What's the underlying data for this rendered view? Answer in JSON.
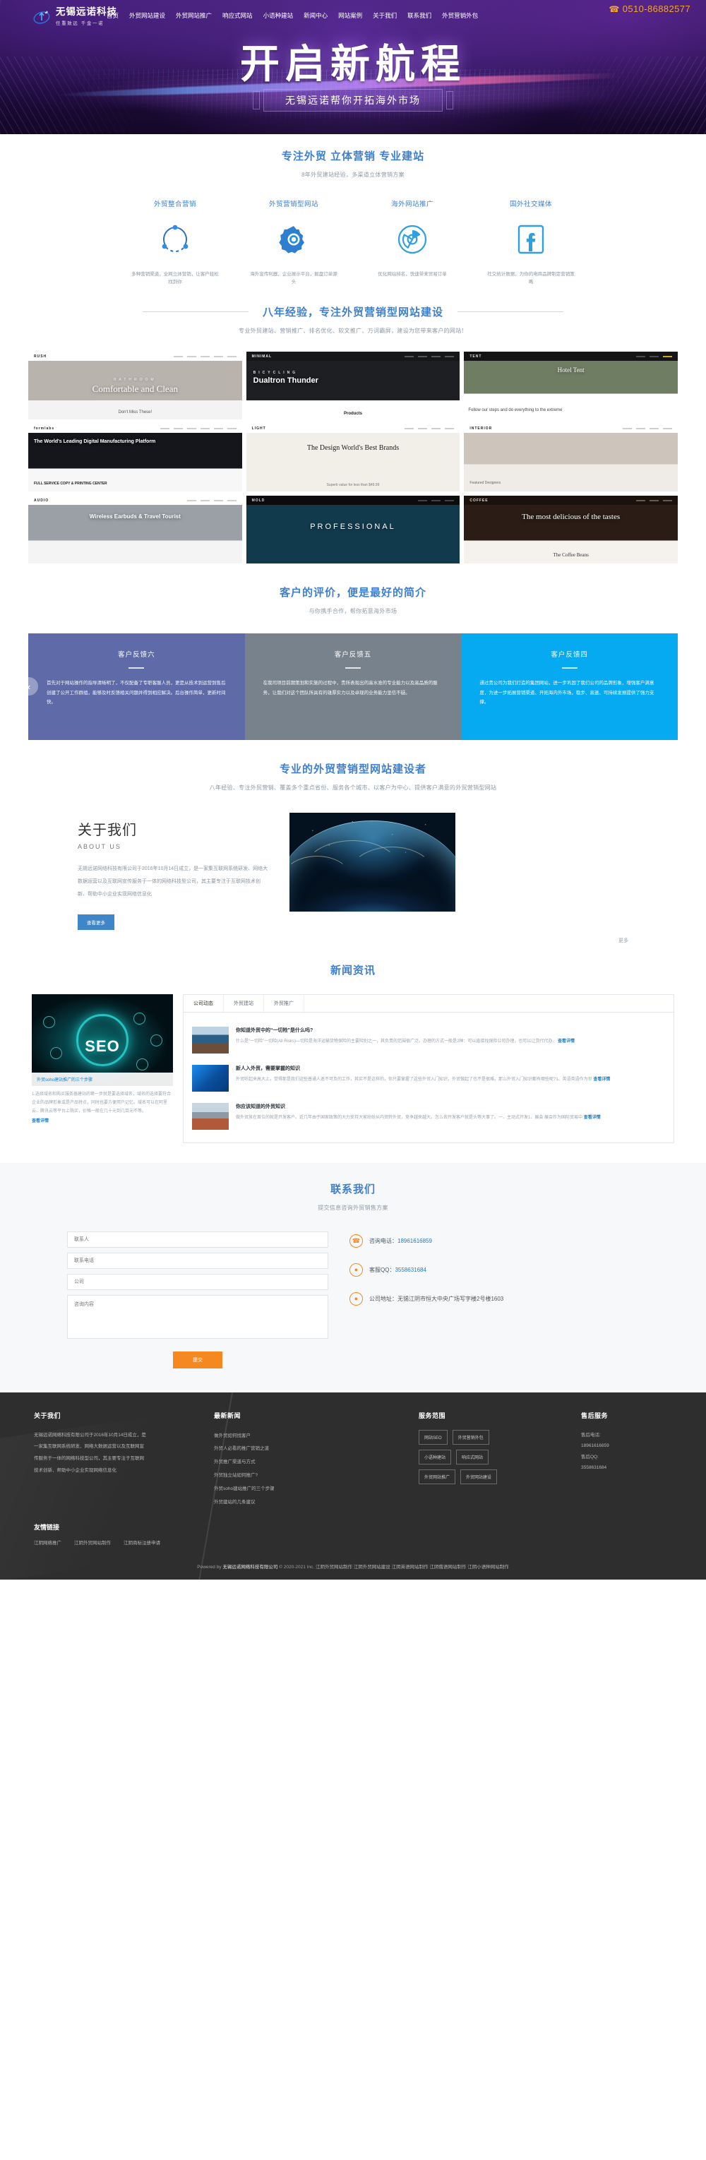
{
  "header": {
    "phone": "0510-86882577",
    "phone_icon": "phone-icon",
    "brand_name": "无锡远诺科技",
    "brand_slogan": "任重致远 千金一诺",
    "nav": [
      {
        "label": "首页"
      },
      {
        "label": "外贸网站建设"
      },
      {
        "label": "外贸网站推广"
      },
      {
        "label": "响应式网站"
      },
      {
        "label": "小语种建站"
      },
      {
        "label": "新闻中心"
      },
      {
        "label": "网站案例"
      },
      {
        "label": "关于我们"
      },
      {
        "label": "联系我们"
      },
      {
        "label": "外贸营销外包"
      }
    ]
  },
  "hero": {
    "title": "开启新航程",
    "subtitle": "无锡远诺帮你开拓海外市场"
  },
  "services": {
    "title": "专注外贸 立体营销 专业建站",
    "subtitle": "8年外贸建站经验，多渠道立体营销方案",
    "items": [
      {
        "name": "外贸整合营销",
        "icon": "network-circle-icon",
        "desc": "多种营销渠道，全网立体营销，让客户轻松找到你"
      },
      {
        "name": "外贸营销型网站",
        "icon": "gear-icon",
        "desc": "海外宣传利器，企业展示平台，掘盘订单源头"
      },
      {
        "name": "海外网站推广",
        "icon": "chrome-icon",
        "desc": "优化网站排名，快速带来贸易订单"
      },
      {
        "name": "国外社交媒体",
        "icon": "facebook-icon",
        "desc": "社交统计数据，为你的电商品牌制定营销策略"
      }
    ]
  },
  "cases": {
    "title": "八年经验，专注外贸营销型网站建设",
    "subtitle": "专业外贸建站、营销推广、排名优化、软文推广、万词霸屏，建设为您带来客户的网站！",
    "items": [
      {
        "logo": "RUSH",
        "eyebrow": "BATHROOM",
        "headline": "Comfortable and Clean",
        "footer": "Don't Miss These!",
        "tone": "light"
      },
      {
        "logo": "",
        "eyebrow": "BICYCLING",
        "headline": "Dualtron Thunder",
        "footer": "Products",
        "tone": "dark"
      },
      {
        "logo": "",
        "eyebrow": "",
        "headline": "Hotel Tent",
        "footer": "Follow our steps and do everything to the extreme",
        "tone": "nature"
      },
      {
        "logo": "formlabs",
        "eyebrow": "",
        "headline": "The World's Leading Digital Manufacturing Platform",
        "footer": "FULL SERVICE COPY & PRINTING CENTER",
        "tone": "dark"
      },
      {
        "logo": "LIGHT",
        "eyebrow": "",
        "headline": "The Design World's Best Brands",
        "footer": "Superb value for less than $49.99",
        "tone": "light"
      },
      {
        "logo": "",
        "eyebrow": "",
        "headline": "",
        "footer": "Featured Designers",
        "tone": "interior"
      },
      {
        "logo": "",
        "eyebrow": "",
        "headline": "Wireless Earbuds & Travel Tourist",
        "footer": "",
        "tone": "gray"
      },
      {
        "logo": "MOLD",
        "eyebrow": "",
        "headline": "PROFESSIONAL",
        "footer": "",
        "tone": "teal"
      },
      {
        "logo": "",
        "eyebrow": "",
        "headline": "The most delicious of the tastes",
        "footer": "The Coffee Beans",
        "tone": "coffee"
      }
    ]
  },
  "testimonials": {
    "title": "客户的评价，便是最好的简介",
    "subtitle": "与你携手合作，帮你拓意海外市场",
    "prev_icon": "chevron-left-icon",
    "items": [
      {
        "name": "客户反馈六",
        "text": "首先对于网站操作的指导清晰明了，不仅配备了专职客服人员，更是从技术到运营到售后创建了公开工作群组，能够及时反馈相关问题并得到相应解决。后台操作简单，更新时间快。",
        "color": "#5f6ba8"
      },
      {
        "name": "客户反馈五",
        "text": "在我司项目前期策划和实施的过程中，贵所表现出的高水准的专业能力以及高品质的服务，让我们对这个团队所具有的雄厚实力以及卓现的业务能力坚信不疑。",
        "color": "#78828c"
      },
      {
        "name": "客户反馈四",
        "text": "通过贵公司为我们打造的集团网站，进一步巩固了我们公司的品牌形象，增强客户满意度，为进一步拓展营销渠道、开拓海内外市场，稳步、高速、可持续发展提供了强力支撑。",
        "color": "#06aaf0"
      }
    ]
  },
  "about": {
    "section_title": "专业的外贸营销型网站建设者",
    "section_subtitle": "八年经验、专注外贸营销、覆盖多个重点省份、服务各个城市、以客户为中心、提供客户满意的外贸营销型网站",
    "heading": "关于我们",
    "heading_en": "ABOUT US",
    "body": "无锡远诺网络科技有限公司于2016年10月14日成立，是一家集互联网系统研发、网络大数据运营以及互联网宣传服务于一体的网络科技型公司，其主要专注于互联网技术创新、帮助中小企业实现网络信息化",
    "button": "查看更多",
    "more": "更多"
  },
  "news": {
    "title": "新闻资讯",
    "feature_image_label": "SEO",
    "feature_caption": "外贸soho建站推广的三个步骤",
    "feature_note": "1.选择域名和购买服务器建站的第一步就是要选择域名，域名的选择要符合企业的品牌形象或是产品特点，同时也要方便用户记忆。域名可以在阿里云、腾讯云等平台上购买，价格一般在几十元到几百元不等。",
    "feature_more": "查看详情",
    "tabs": [
      {
        "label": "公司动态",
        "active": true
      },
      {
        "label": "外贸建站",
        "active": false
      },
      {
        "label": "外贸推广",
        "active": false
      }
    ],
    "items": [
      {
        "title": "你知道外贸中的“一切险”是什么吗?",
        "desc": "什么是“一切险”一切险(All Risks)—切险是海洋运输货物保险的主要险别之一，其负责的范围很广泛。办理的方式一般是2种：可以直接找保险公司办理，也可以让货代代办。",
        "link": "查看详情",
        "thumb": "coast-photo"
      },
      {
        "title": "新人入外贸，需要掌握的知识",
        "desc": "外贸听起来高大上，觉得那是我们这些普通人遥不可及的工作，其实不是这样的，你只要掌握了这些外贸入门知识，外贸做起了也不是很难。那么外贸入门知识都有哪些呢?1、英语英语作为世",
        "link": "查看详情",
        "thumb": "blue-cube-photo"
      },
      {
        "title": "你应该知道的外贸知识",
        "desc": "做外贸放在首位的就是开发客户。近几年由于国家政策的大力支持大家纷纷从内贸转外贸，竞争越来越大。怎么去开发客户就是头等大事了。一、主动式开发1、展会 展会作为国际贸易中",
        "link": "查看详情",
        "thumb": "port-photo"
      }
    ]
  },
  "contact": {
    "title": "联系我们",
    "subtitle": "提交信息咨询外贸销售方案",
    "fields": [
      {
        "name": "contact-name-field",
        "placeholder": "联系人"
      },
      {
        "name": "contact-phone-field",
        "placeholder": "联系电话"
      },
      {
        "name": "contact-company-field",
        "placeholder": "公司"
      }
    ],
    "textarea_placeholder": "咨询内容",
    "submit": "提交",
    "info": [
      {
        "icon": "phone-icon",
        "label": "咨询电话：",
        "value": "18961616859"
      },
      {
        "icon": "qq-icon",
        "label": "客服QQ：",
        "value": "3558631684"
      },
      {
        "icon": "location-pin-icon",
        "label": "公司地址：",
        "value": "无锡江阴市恒大中央广场写字楼2号楼1603"
      }
    ]
  },
  "footer": {
    "about": {
      "title": "关于我们",
      "text": "无锡远诺网络科技有限公司于2016年10月14日成立，是一家集互联网系统研发、网络大数据运营以及互联网宣传服务于一体的网络科技型公司，其主要专注于互联网技术创新、帮助中小企业实现网络信息化"
    },
    "news": {
      "title": "最新新闻",
      "items": [
        "做外贸如何找客户",
        "外贸人必看的推广营销之道",
        "外贸推广渠道与方式",
        "外贸独立站如何推广?",
        "外贸soho建站推广的三个步骤",
        "外贸建站的几条建议"
      ]
    },
    "services": {
      "title": "服务范围",
      "tags": [
        "网站SEO",
        "外贸营销外包",
        "小语种建站",
        "响应式网站",
        "外贸网站推广",
        "外贸网站建设"
      ]
    },
    "support": {
      "title": "售后服务",
      "lines": [
        "售后电话:",
        "18961616859",
        "售后QQ:",
        "3558631684"
      ]
    },
    "friendly_links": {
      "title": "友情链接",
      "items": [
        "江阴网络推广",
        "江阴外贸网站制作",
        "江阴商标注册申请"
      ]
    },
    "copyright": {
      "powered": "Powered by",
      "company": "无锡远诺网络科技有限公司",
      "years": "© 2020-2021 Inc.",
      "links": [
        "江阴外贸网站制作",
        "江阴外贸网站建设",
        "江阴英语网站制作",
        "江阴俄语网站制作",
        "江阴小语种网站制作"
      ]
    }
  }
}
